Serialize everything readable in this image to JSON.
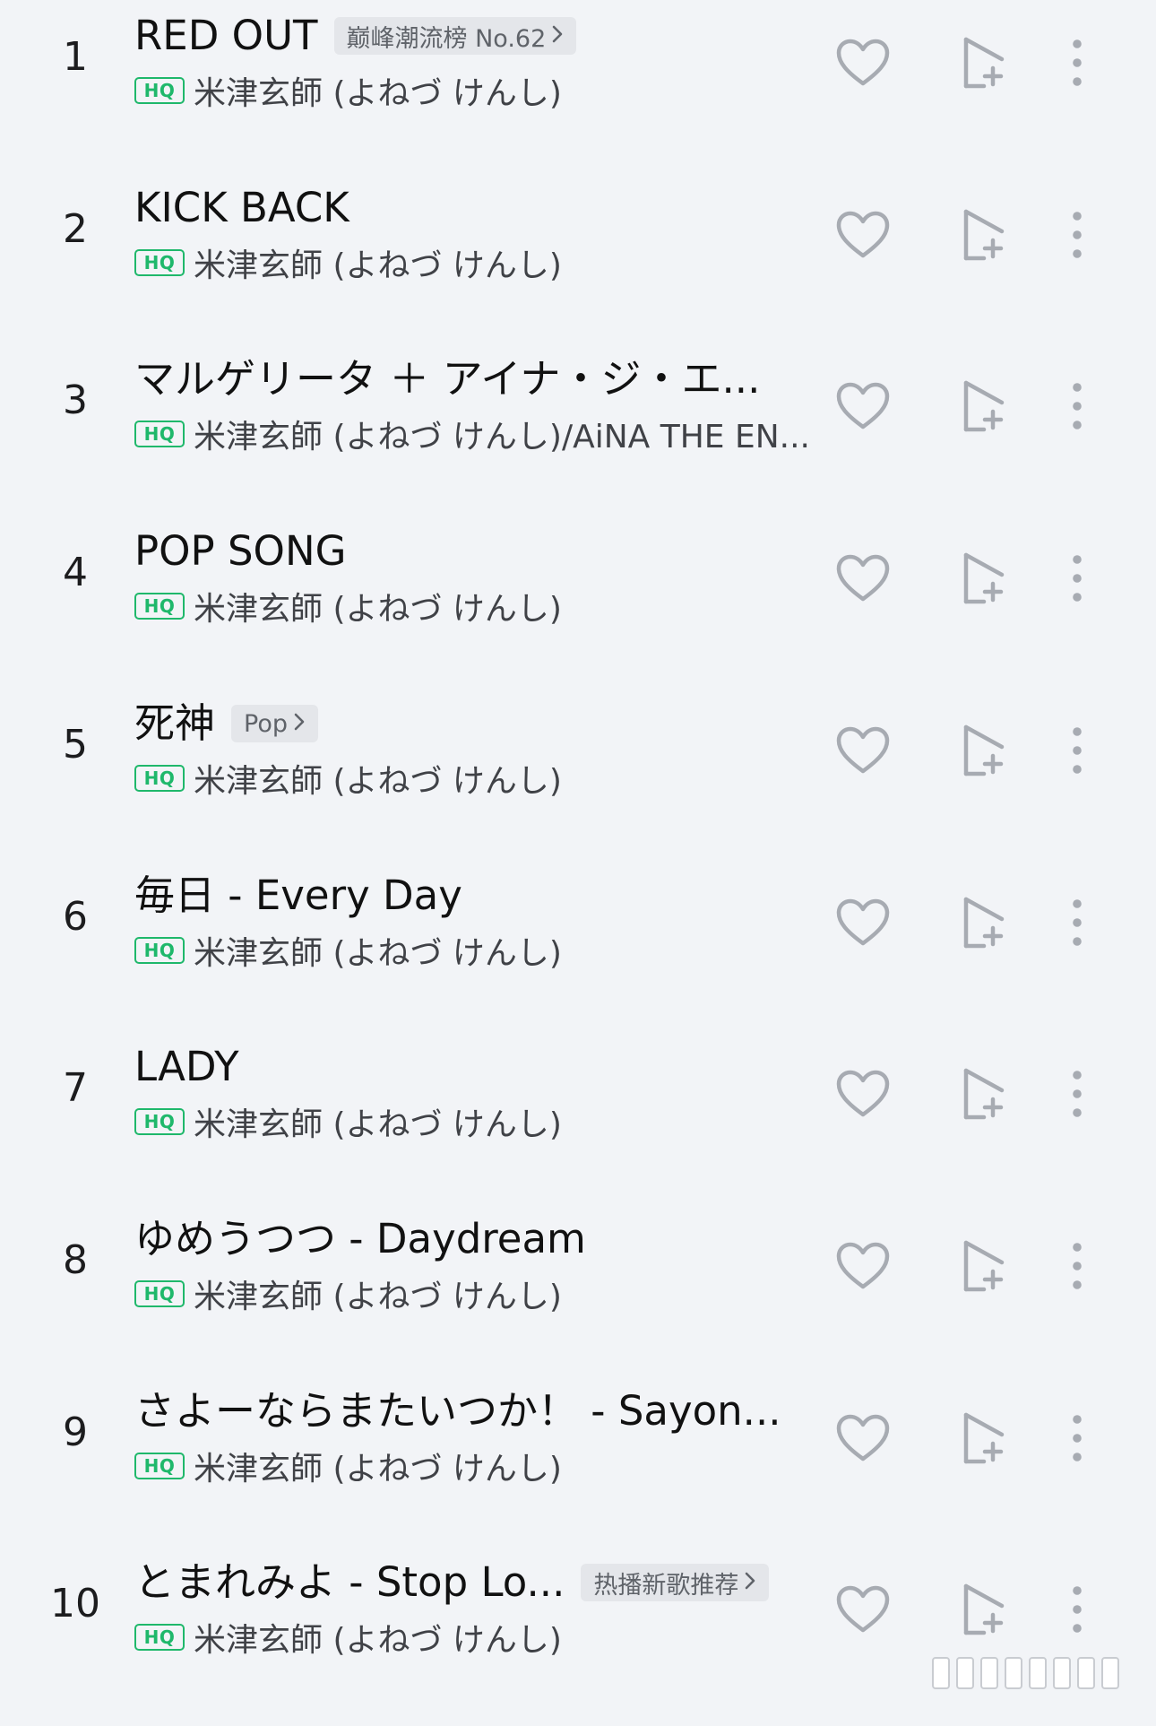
{
  "colors": {
    "background": "#f2f4f7",
    "hq_badge": "#1fb86b",
    "icon_gray": "#a7abb2",
    "tag_bg": "#e4e6ea"
  },
  "icons": {
    "like": "heart-outline-icon",
    "add": "add-to-playlist-icon",
    "more": "more-vertical-icon",
    "tag_chevron": "chevron-right-icon"
  },
  "hq_label": "HQ",
  "tracks": [
    {
      "index": "1",
      "title": "RED OUT",
      "tag": "巅峰潮流榜 No.62",
      "artist": "米津玄師 (よねづ けんし)"
    },
    {
      "index": "2",
      "title": "KICK BACK",
      "tag": "",
      "artist": "米津玄師 (よねづ けんし)"
    },
    {
      "index": "3",
      "title": "マルゲリータ ＋ アイナ・ジ・エ...",
      "tag": "",
      "artist": "米津玄師 (よねづ けんし)/AiNA THE EN..."
    },
    {
      "index": "4",
      "title": "POP SONG",
      "tag": "",
      "artist": "米津玄師 (よねづ けんし)"
    },
    {
      "index": "5",
      "title": "死神",
      "tag": "Pop",
      "artist": "米津玄師 (よねづ けんし)"
    },
    {
      "index": "6",
      "title": "毎日 - Every Day",
      "tag": "",
      "artist": "米津玄師 (よねづ けんし)"
    },
    {
      "index": "7",
      "title": "LADY",
      "tag": "",
      "artist": "米津玄師 (よねづ けんし)"
    },
    {
      "index": "8",
      "title": "ゆめうつつ - Daydream",
      "tag": "",
      "artist": "米津玄師 (よねづ けんし)"
    },
    {
      "index": "9",
      "title": "さよーならまたいつか！ - Sayon...",
      "tag": "",
      "artist": "米津玄師 (よねづ けんし)"
    },
    {
      "index": "10",
      "title": "とまれみよ - Stop Lo...",
      "tag": "热播新歌推荐",
      "artist": "米津玄師 (よねづ けんし)"
    }
  ]
}
